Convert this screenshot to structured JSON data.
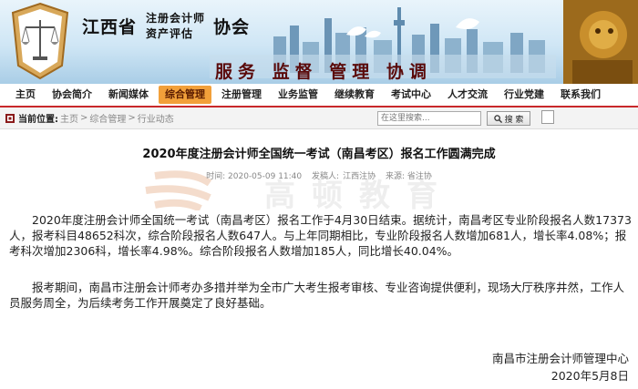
{
  "header": {
    "org_province": "江西省",
    "org_line1": "注册会计师",
    "org_line2": "资产评估",
    "org_assoc": "协会",
    "slogan": "服务 监督 管理 协调"
  },
  "nav": {
    "items": [
      {
        "label": "主页"
      },
      {
        "label": "协会简介"
      },
      {
        "label": "新闻媒体"
      },
      {
        "label": "综合管理"
      },
      {
        "label": "注册管理"
      },
      {
        "label": "业务监管"
      },
      {
        "label": "继续教育"
      },
      {
        "label": "考试中心"
      },
      {
        "label": "人才交流"
      },
      {
        "label": "行业党建"
      },
      {
        "label": "联系我们"
      }
    ],
    "active_index": 3
  },
  "location": {
    "label": "当前位置:",
    "crumbs": [
      "主页",
      "综合管理",
      "行业动态"
    ],
    "separator": ">"
  },
  "search": {
    "placeholder": "在这里搜索...",
    "button_label": "搜 索"
  },
  "article": {
    "title": "2020年度注册会计师全国统一考试（南昌考区）报名工作圆满完成",
    "meta": {
      "time": "时间: 2020-05-09 11:40",
      "publisher_label": "发稿人:",
      "publisher": "江西注协",
      "source": "来源: 省注协"
    },
    "watermark": "高顿教育",
    "paragraphs": [
      "2020年度注册会计师全国统一考试（南昌考区）报名工作于4月30日结束。据统计，南昌考区专业阶段报名人数17373人，报考科目48652科次，综合阶段报名人数647人。与上年同期相比，专业阶段报名人数增加681人，增长率4.08%；报考科次增加2306科，增长率4.98%。综合阶段报名人数增加185人，同比增长40.04%。",
      "报考期间，南昌市注册会计师考办多措并举为全市广大考生报考审核、专业咨询提供便利，现场大厅秩序井然，工作人员服务周全，为后续考务工作开展奠定了良好基础。"
    ],
    "signature": "南昌市注册会计师管理中心",
    "date": "2020年5月8日"
  },
  "colors": {
    "nav_active": "#f2a03a",
    "nav_border": "#c8282a",
    "slogan": "#5a0a0a"
  }
}
